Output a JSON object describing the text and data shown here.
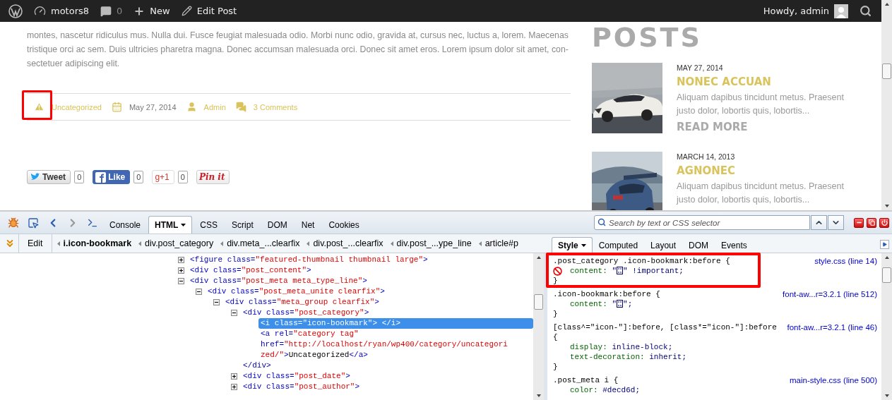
{
  "admin_bar": {
    "site": "motors8",
    "comments": "0",
    "new": "New",
    "edit": "Edit Post",
    "greeting": "Howdy, admin"
  },
  "post": {
    "excerpt": "montes, nascetur ridiculus mus. Nulla dui. Fusce feugiat malesuada odio. Morbi nunc odio, gravida at, cursus nec, luctus a, lorem. Maecenas tristique orci ac sem. Duis ultricies pharetra magna. Donec accumsan malesuada orci. Donec sit amet eros. Lorem ipsum dolor sit amet, con-sectetuer adipiscing elit.",
    "meta": [
      {
        "kind": "category",
        "text": "Uncategorized",
        "highlighted": true
      },
      {
        "kind": "date",
        "text": "May 27, 2014",
        "highlighted": false
      },
      {
        "kind": "author",
        "text": "Admin",
        "highlighted": false
      },
      {
        "kind": "comments",
        "text": "3 Comments",
        "highlighted": false
      }
    ],
    "share": [
      {
        "kind": "twitter",
        "label": "Tweet",
        "count": "0"
      },
      {
        "kind": "facebook",
        "label": "Like",
        "count": "0"
      },
      {
        "kind": "gplus",
        "label": "g+1",
        "count": "0"
      },
      {
        "kind": "pinterest",
        "label": "Pin it"
      }
    ]
  },
  "sidebar": {
    "heading": "POSTS",
    "posts": [
      {
        "date": "MAY 27, 2014",
        "title": "NONEC ACCUAN",
        "excerpt": "Aliquam dapibus tincidunt metus. Praesent justo dolor, lobortis quis, lobortis...",
        "more": "READ MORE"
      },
      {
        "date": "MARCH 14, 2013",
        "title": "AGNONEC",
        "excerpt": "Aliquam dapibus tincidunt metus. Praesent justo dolor, lobortis quis, lobortis..."
      }
    ]
  },
  "devtools": {
    "tabs": [
      {
        "label": "Console",
        "selected": false
      },
      {
        "label": "HTML",
        "selected": true
      },
      {
        "label": "CSS",
        "selected": false
      },
      {
        "label": "Script",
        "selected": false
      },
      {
        "label": "DOM",
        "selected": false
      },
      {
        "label": "Net",
        "selected": false
      },
      {
        "label": "Cookies",
        "selected": false
      }
    ],
    "search": {
      "placeholder": "Search by text or CSS selector"
    },
    "edit": "Edit",
    "breadcrumbs": [
      {
        "label": "i.icon-bookmark",
        "selected": true
      },
      {
        "label": "div.post_category",
        "selected": false
      },
      {
        "label": "div.meta_...clearfix",
        "selected": false
      },
      {
        "label": "div.post_...clearfix",
        "selected": false
      },
      {
        "label": "div.post_...ype_line",
        "selected": false
      },
      {
        "label": "article#p",
        "selected": false
      }
    ],
    "side_tabs": [
      {
        "label": "Style",
        "selected": true
      },
      {
        "label": "Computed",
        "selected": false
      },
      {
        "label": "Layout",
        "selected": false
      },
      {
        "label": "DOM",
        "selected": false
      },
      {
        "label": "Events",
        "selected": false
      }
    ],
    "html_tree": [
      {
        "start": "<figure",
        "attrs": [
          {
            "name": "class=",
            "value": "\"featured-thumbnail thumbnail large\""
          }
        ],
        "end": ">",
        "expanded": false,
        "selected": false
      },
      {
        "start": "<div",
        "attrs": [
          {
            "name": "class=",
            "value": "\"post_content\""
          }
        ],
        "end": ">",
        "expanded": false,
        "selected": false
      },
      {
        "start": "<div",
        "attrs": [
          {
            "name": "class=",
            "value": "\"post_meta meta_type_line\""
          }
        ],
        "end": ">",
        "expanded": true,
        "selected": false,
        "children": [
          {
            "start": "<div",
            "attrs": [
              {
                "name": "class=",
                "value": "\"post_meta_unite clearfix\""
              }
            ],
            "end": ">",
            "expanded": true,
            "selected": false,
            "children": [
              {
                "start": "<div",
                "attrs": [
                  {
                    "name": "class=",
                    "value": "\"meta_group clearfix\""
                  }
                ],
                "end": ">",
                "expanded": true,
                "selected": false,
                "children": [
                  {
                    "start": "<div",
                    "attrs": [
                      {
                        "name": "class=",
                        "value": "\"post_category\""
                      }
                    ],
                    "end": ">",
                    "expanded": true,
                    "selected": false,
                    "closing_line": "</div>",
                    "children": [
                      {
                        "start": "<i",
                        "attrs": [
                          {
                            "name": "class=",
                            "value": "\"icon-bookmark\""
                          }
                        ],
                        "end": ">",
                        "closing": "</i>",
                        "selected": true
                      },
                      {
                        "start": "<a",
                        "attrs": [
                          {
                            "name": "rel=",
                            "value": "\"category tag\""
                          },
                          {
                            "name": "href=",
                            "value": "\"http://localhost/ryan/wp400/category/uncategorized/\""
                          }
                        ],
                        "end": ">",
                        "text": "Uncategorized",
                        "closing": "</a>",
                        "selected": false
                      }
                    ]
                  },
                  {
                    "start": "<div",
                    "attrs": [
                      {
                        "name": "class=",
                        "value": "\"post_date\""
                      }
                    ],
                    "end": ">",
                    "expanded": false,
                    "selected": false
                  },
                  {
                    "start": "<div",
                    "attrs": [
                      {
                        "name": "class=",
                        "value": "\"post_author\""
                      }
                    ],
                    "end": ">",
                    "expanded": false,
                    "selected": false
                  }
                ]
              }
            ]
          }
        ]
      }
    ],
    "css_rules": [
      {
        "selector": ".post_category .icon-bookmark:before {",
        "source": "style.css (line 14)",
        "highlighted": true,
        "declarations": [
          {
            "property": "content:",
            "prefix": "\"",
            "missing_glyph": true,
            "suffix": "\" !important;",
            "disabled": true
          }
        ],
        "close": "}"
      },
      {
        "selector": ".icon-bookmark:before {",
        "source": "font-aw...r=3.2.1 (line 512)",
        "highlighted": false,
        "declarations": [
          {
            "property": "content:",
            "prefix": "\"",
            "missing_glyph": true,
            "suffix": "\";",
            "disabled": false
          }
        ],
        "close": "}"
      },
      {
        "selector": "[class^=\"icon-\"]:before, [class*=\"icon-\"]:before {",
        "source": "font-aw...r=3.2.1 (line 46)",
        "highlighted": false,
        "declarations": [
          {
            "property": "display:",
            "value": "inline-block;",
            "disabled": false
          },
          {
            "property": "text-decoration:",
            "value": "inherit;",
            "disabled": false
          }
        ],
        "close": "}"
      },
      {
        "selector": ".post_meta i {",
        "source": "main-style.css (line 500)",
        "highlighted": false,
        "declarations": [
          {
            "property": "color:",
            "value": "#decd6d;",
            "disabled": false
          }
        ]
      }
    ]
  }
}
